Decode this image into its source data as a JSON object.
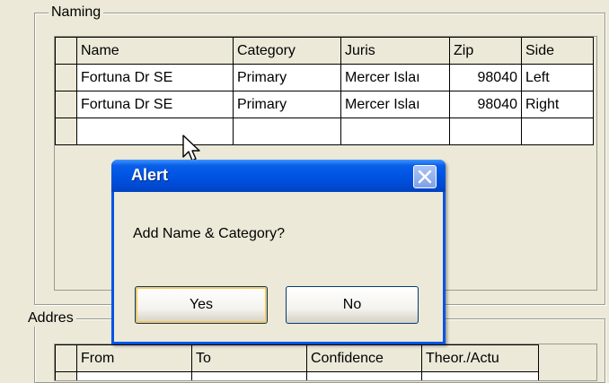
{
  "naming": {
    "title": "Naming",
    "columns": [
      "Name",
      "Category",
      "Juris",
      "Zip",
      "Side"
    ],
    "rows": [
      {
        "name": "Fortuna Dr SE",
        "category": "Primary",
        "juris": "Mercer Islaı",
        "zip": "98040",
        "side": "Left"
      },
      {
        "name": "Fortuna Dr SE",
        "category": "Primary",
        "juris": "Mercer Islaı",
        "zip": "98040",
        "side": "Right"
      }
    ]
  },
  "address": {
    "title": "Addres",
    "columns": [
      "From",
      "To",
      "Confidence",
      "Theor./Actu"
    ]
  },
  "dialog": {
    "title": "Alert",
    "message": "Add Name & Category?",
    "yes_label": "Yes",
    "no_label": "No",
    "close_icon": "close-icon"
  },
  "colors": {
    "titlebar": "#0054e3",
    "window_bg": "#ece9d8",
    "default_button_focus": "#f9c75c"
  }
}
